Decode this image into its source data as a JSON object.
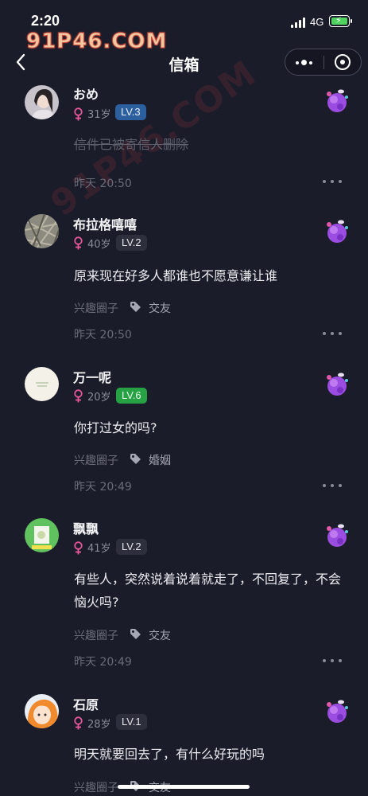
{
  "status_bar": {
    "time": "2:20",
    "network": "4G"
  },
  "watermark": {
    "top_text": "91P46.COM",
    "diagonal_text": "91P46.COM"
  },
  "header": {
    "title": "信箱"
  },
  "letters": [
    {
      "username": "おめ",
      "age": "31岁",
      "level": "LV.3",
      "message": "信件已被寄信人删除",
      "deleted": true,
      "time": "昨天 20:50"
    },
    {
      "username": "布拉格嘻嘻",
      "age": "40岁",
      "level": "LV.2",
      "message": "原来现在好多人都谁也不愿意谦让谁",
      "circle": "兴趣圈子",
      "tag": "交友",
      "time": "昨天 20:50"
    },
    {
      "username": "万一呢",
      "age": "20岁",
      "level": "LV.6",
      "message": "你打过女的吗?",
      "circle": "兴趣圈子",
      "tag": "婚姻",
      "time": "昨天 20:49"
    },
    {
      "username": "飘飘",
      "age": "41岁",
      "level": "LV.2",
      "message": "有些人，突然说着说着就走了，不回复了，不会恼火吗?",
      "circle": "兴趣圈子",
      "tag": "交友",
      "time": "昨天 20:49"
    },
    {
      "username": "石原",
      "age": "28岁",
      "level": "LV.1",
      "message": "明天就要回去了，有什么好玩的吗",
      "circle": "兴趣圈子",
      "tag": "交友"
    }
  ],
  "colors": {
    "background": "#1b1c2a",
    "female": "#e8579a",
    "lv_blue": "#2c5f9e",
    "lv_green": "#26a144",
    "lv_dark": "#2e2f3d"
  }
}
